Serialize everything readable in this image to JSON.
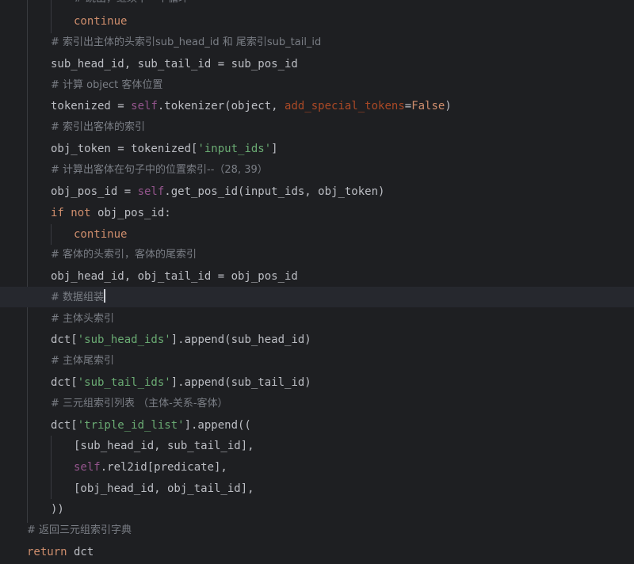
{
  "editor": {
    "lines": {
      "l0": "# 跳出，继续下一个循环",
      "l1_kw": "continue",
      "l2": "# 索引出主体的头索引sub_head_id 和 尾索引sub_tail_id",
      "l3": "sub_head_id, sub_tail_id = sub_pos_id",
      "l4": "# 计算 object 客体位置",
      "l5_a": "tokenized = ",
      "l5_self": "self",
      "l5_b": ".tokenizer(object, ",
      "l5_param": "add_special_tokens",
      "l5_c": "=",
      "l5_false": "False",
      "l5_d": ")",
      "l6": "# 索引出客体的索引",
      "l7_a": "obj_token = tokenized[",
      "l7_str": "'input_ids'",
      "l7_b": "]",
      "l8": "# 计算出客体在句子中的位置索引--（28, 39）",
      "l9_a": "obj_pos_id = ",
      "l9_self": "self",
      "l9_b": ".get_pos_id(input_ids, obj_token)",
      "l10_if": "if",
      "l10_not": "not",
      "l10_b": " obj_pos_id:",
      "l11_kw": "continue",
      "l12": "# 客体的头索引，客体的尾索引",
      "l13": "obj_head_id, obj_tail_id = obj_pos_id",
      "l14": "# 数据组装",
      "l15": "# 主体头索引",
      "l16_a": "dct[",
      "l16_str": "'sub_head_ids'",
      "l16_b": "].append(sub_head_id)",
      "l17": "# 主体尾索引",
      "l18_a": "dct[",
      "l18_str": "'sub_tail_ids'",
      "l18_b": "].append(sub_tail_id)",
      "l19": "# 三元组索引列表 （主体-关系-客体）",
      "l20_a": "dct[",
      "l20_str": "'triple_id_list'",
      "l20_b": "].append((",
      "l21": "[sub_head_id, sub_tail_id],",
      "l22_self": "self",
      "l22_b": ".rel2id[predicate],",
      "l23": "[obj_head_id, obj_tail_id],",
      "l24": "))",
      "l25": "# 返回三元组索引字典",
      "l26_kw": "return",
      "l26_b": " dct"
    }
  },
  "colors": {
    "background": "#1e1f22",
    "current_line": "#26282e",
    "keyword": "#cf8e6d",
    "self": "#94558d",
    "string": "#6aab73",
    "param": "#aa4926",
    "comment": "#7a7e85",
    "text": "#bcbec4"
  }
}
